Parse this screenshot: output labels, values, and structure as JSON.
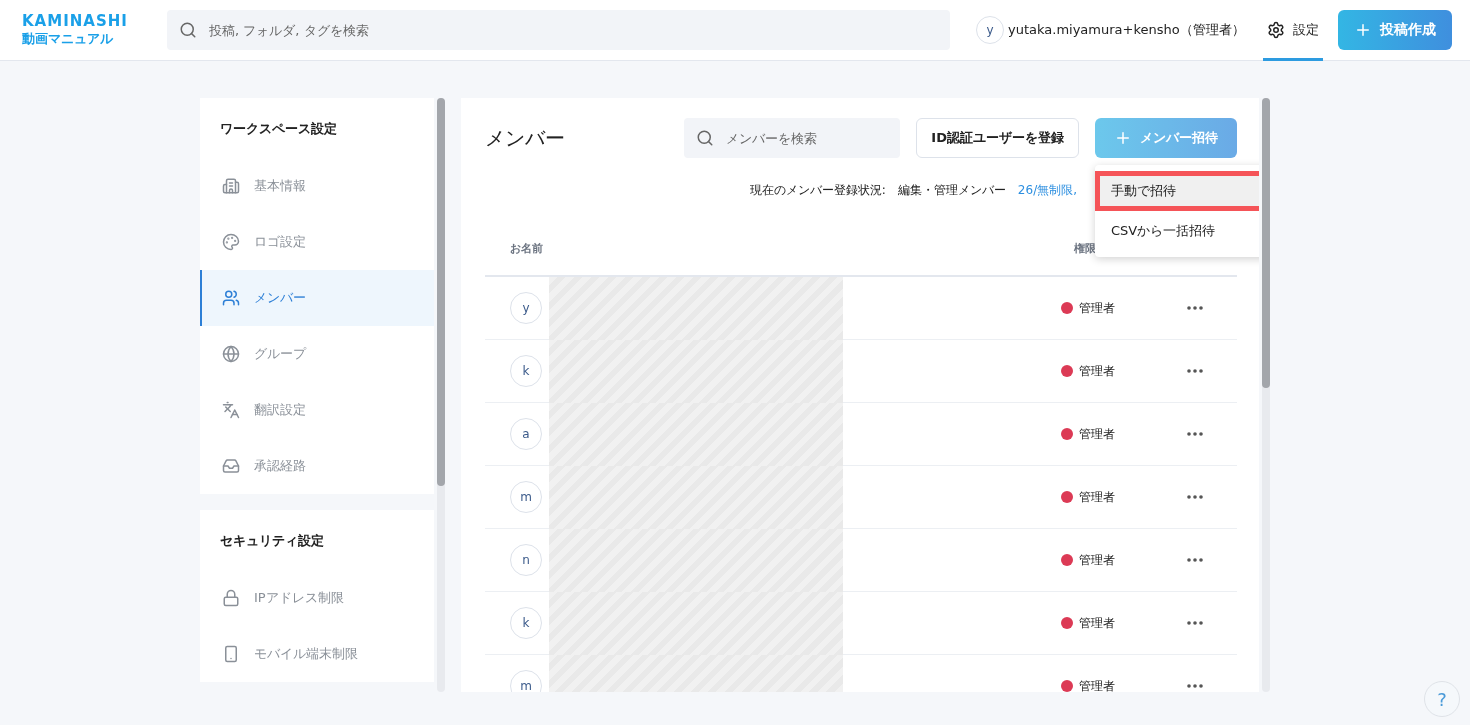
{
  "header": {
    "logo_top": "KAMINASHI",
    "logo_bottom": "動画マニュアル",
    "search": {
      "placeholder": "投稿, フォルダ, タグを検索"
    },
    "user": {
      "initial": "y",
      "name": "yutaka.miyamura+kensho（管理者）"
    },
    "settings": {
      "label": "設定",
      "selected": true
    },
    "create_button": "投稿作成"
  },
  "sidebar": [
    {
      "title": "ワークスペース設定",
      "items": [
        {
          "kind": "building",
          "label": "基本情報",
          "selected": false
        },
        {
          "kind": "palette",
          "label": "ロゴ設定",
          "selected": false
        },
        {
          "kind": "users",
          "label": "メンバー",
          "selected": true
        },
        {
          "kind": "group",
          "label": "グループ",
          "selected": false
        },
        {
          "kind": "translate",
          "label": "翻訳設定",
          "selected": false
        },
        {
          "kind": "inbox",
          "label": "承認経路",
          "selected": false
        }
      ]
    },
    {
      "title": "セキュリティ設定",
      "items": [
        {
          "kind": "lock",
          "label": "IPアドレス制限",
          "selected": false
        },
        {
          "kind": "phone",
          "label": "モバイル端末制限",
          "selected": false
        }
      ]
    }
  ],
  "main": {
    "title": "メンバー",
    "search": {
      "placeholder": "メンバーを検索"
    },
    "id_button": "ID認証ユーザーを登録",
    "invite_button": "メンバー招待",
    "status": {
      "label": "現在のメンバー登録状況:",
      "type": "編集・管理メンバー",
      "count": "26/無制限",
      "separator": ","
    },
    "columns": [
      "お名前",
      "権限"
    ],
    "rows": [
      {
        "initial": "y",
        "role": "管理者"
      },
      {
        "initial": "k",
        "role": "管理者"
      },
      {
        "initial": "a",
        "role": "管理者"
      },
      {
        "initial": "m",
        "role": "管理者"
      },
      {
        "initial": "n",
        "role": "管理者"
      },
      {
        "initial": "k",
        "role": "管理者"
      },
      {
        "initial": "m",
        "role": "管理者"
      }
    ],
    "menu": [
      {
        "label": "手動で招待",
        "highlighted": true
      },
      {
        "label": "CSVから一括招待",
        "highlighted": false
      }
    ]
  },
  "help": "?"
}
